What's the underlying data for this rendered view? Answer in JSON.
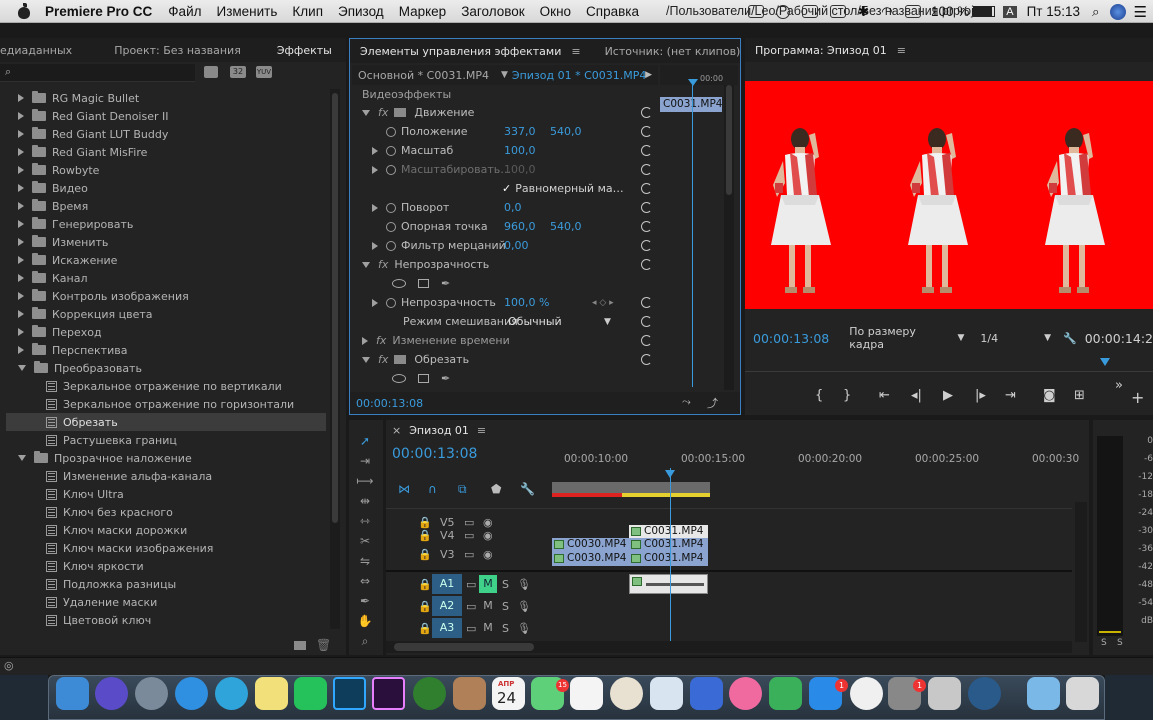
{
  "menubar": {
    "app": "Premiere Pro CC",
    "items": [
      "Файл",
      "Изменить",
      "Клип",
      "Эпизод",
      "Маркер",
      "Заголовок",
      "Окно",
      "Справка"
    ],
    "path": "/Пользователи/Leo/Рабочий стол/Без названия.prproj *",
    "battery": "100 %",
    "input": "A",
    "clock": "Пт 15:13"
  },
  "left_panel": {
    "tabs": [
      "едиаданных",
      "Проект: Без названия",
      "Эффекты"
    ],
    "search_placeholder": "",
    "badges": [
      "32",
      "YUV"
    ],
    "tree": [
      {
        "label": "RG Magic Bullet",
        "type": "folder"
      },
      {
        "label": "Red Giant Denoiser II",
        "type": "folder"
      },
      {
        "label": "Red Giant LUT Buddy",
        "type": "folder"
      },
      {
        "label": "Red Giant MisFire",
        "type": "folder"
      },
      {
        "label": "Rowbyte",
        "type": "folder"
      },
      {
        "label": "Видео",
        "type": "folder"
      },
      {
        "label": "Время",
        "type": "folder"
      },
      {
        "label": "Генерировать",
        "type": "folder"
      },
      {
        "label": "Изменить",
        "type": "folder"
      },
      {
        "label": "Искажение",
        "type": "folder"
      },
      {
        "label": "Канал",
        "type": "folder"
      },
      {
        "label": "Контроль изображения",
        "type": "folder"
      },
      {
        "label": "Коррекция цвета",
        "type": "folder"
      },
      {
        "label": "Переход",
        "type": "folder"
      },
      {
        "label": "Перспектива",
        "type": "folder"
      },
      {
        "label": "Преобразовать",
        "type": "folder-open"
      },
      {
        "label": "Зеркальное отражение по вертикали",
        "type": "effect"
      },
      {
        "label": "Зеркальное отражение по горизонтали",
        "type": "effect"
      },
      {
        "label": "Обрезать",
        "type": "effect-selected"
      },
      {
        "label": "Растушевка границ",
        "type": "effect"
      },
      {
        "label": "Прозрачное наложение",
        "type": "folder-open"
      },
      {
        "label": "Изменение альфа-канала",
        "type": "effect"
      },
      {
        "label": "Ключ Ultra",
        "type": "effect"
      },
      {
        "label": "Ключ без красного",
        "type": "effect"
      },
      {
        "label": "Ключ маски дорожки",
        "type": "effect"
      },
      {
        "label": "Ключ маски изображения",
        "type": "effect"
      },
      {
        "label": "Ключ яркости",
        "type": "effect"
      },
      {
        "label": "Подложка разницы",
        "type": "effect"
      },
      {
        "label": "Удаление маски",
        "type": "effect"
      },
      {
        "label": "Цветовой ключ",
        "type": "effect"
      }
    ]
  },
  "effect_controls": {
    "tabs": [
      "Элементы управления эффектами",
      "Источник: (нет клипов)"
    ],
    "master": "Основной * C0031.MP4",
    "sequence": "Эпизод 01 * C0031.MP4",
    "ruler_time": "00:00",
    "clip_label": "C0031.MP4",
    "section": "Видеоэффекты",
    "rows": [
      {
        "label": "Движение",
        "kind": "fx-header"
      },
      {
        "label": "Положение",
        "v1": "337,0",
        "v2": "540,0"
      },
      {
        "label": "Масштаб",
        "v1": "100,0"
      },
      {
        "label": "Масштабировать…",
        "v1": "100,0",
        "disabled": true
      },
      {
        "label": "Равномерный ма…",
        "kind": "checkbox"
      },
      {
        "label": "Поворот",
        "v1": "0,0"
      },
      {
        "label": "Опорная точка",
        "v1": "960,0",
        "v2": "540,0"
      },
      {
        "label": "Фильтр мерцаний",
        "v1": "0,00"
      },
      {
        "label": "Непрозрачность",
        "kind": "fx-header2"
      },
      {
        "label": "",
        "kind": "shapes"
      },
      {
        "label": "Непрозрачность",
        "v1": "100,0 %"
      },
      {
        "label": "Режим смешивания",
        "select": "Обычный"
      },
      {
        "label": "Изменение времени",
        "kind": "fx-header3"
      },
      {
        "label": "Обрезать",
        "kind": "fx-header"
      },
      {
        "label": "",
        "kind": "shapes"
      }
    ],
    "timecode": "00:00:13:08"
  },
  "program": {
    "title": "Программа: Эпизод 01",
    "timecode": "00:00:13:08",
    "fit": "По размеру кадра",
    "quality": "1/4",
    "duration": "00:00:14:2",
    "colors": {
      "bg": "#ff0000"
    }
  },
  "timeline": {
    "title": "Эпизод 01",
    "timecode": "00:00:13:08",
    "ruler": [
      "00:00:10:00",
      "00:00:15:00",
      "00:00:20:00",
      "00:00:25:00",
      "00:00:30"
    ],
    "video_tracks": [
      "V5",
      "V4",
      "V3"
    ],
    "audio_tracks": [
      "A1",
      "A2",
      "A3"
    ],
    "audio_toggles": {
      "m": "M",
      "s": "S"
    },
    "clips": [
      "C0031.MP4",
      "C0030.MP4",
      "C0031.MP4",
      "C0030.MP4",
      "C0031.MP4"
    ]
  },
  "meter": {
    "labels": [
      "0",
      "-6",
      "-12",
      "-18",
      "-24",
      "-30",
      "-36",
      "-42",
      "-48",
      "-54",
      "dB"
    ],
    "solo": [
      "S",
      "S"
    ]
  },
  "dock": {
    "calendar_month": "АПР",
    "calendar_day": "24",
    "badges": [
      "15",
      "1",
      "1"
    ]
  }
}
